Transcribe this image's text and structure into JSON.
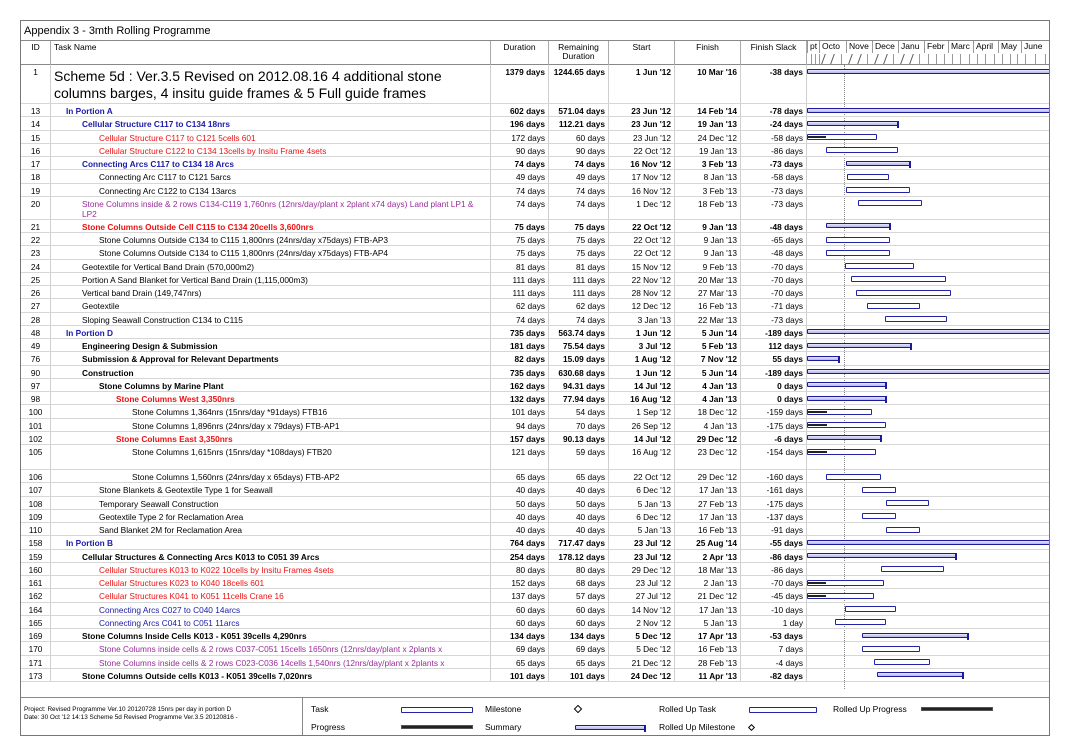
{
  "title": "Appendix 3 - 3mth Rolling Programme",
  "columns": {
    "id": "ID",
    "task_name": "Task Name",
    "duration": "Duration",
    "remaining_duration": "Remaining Duration",
    "start": "Start",
    "finish": "Finish",
    "finish_slack": "Finish Slack"
  },
  "timeline": {
    "months": [
      "pt",
      "Octo",
      "Nove",
      "Dece",
      "Janu",
      "Febr",
      "Marc",
      "April",
      "May",
      "June"
    ]
  },
  "tasks": [
    {
      "id": "1",
      "name": "Scheme 5d : Ver.3.5 Revised on 2012.08.16 4 additional stone columns barges, 4 insitu guide frames & 5 Full guide frames",
      "duration": "1379 days",
      "remaining": "1244.65 days",
      "start": "1 Jun '12",
      "finish": "10 Mar '16",
      "slack": "-38 days",
      "style": "big"
    },
    {
      "id": "13",
      "name": "In Portion A",
      "duration": "602 days",
      "remaining": "571.04 days",
      "start": "23 Jun '12",
      "finish": "14 Feb '14",
      "slack": "-78 days",
      "style": "blue bold",
      "indent": 1
    },
    {
      "id": "14",
      "name": "Cellular Structure C117 to C134 18nrs",
      "duration": "196 days",
      "remaining": "112.21 days",
      "start": "23 Jun '12",
      "finish": "19 Jan '13",
      "slack": "-24 days",
      "style": "blue bold",
      "indent": 2
    },
    {
      "id": "15",
      "name": "Cellular Structure C117 to C121 5cells 601",
      "duration": "172 days",
      "remaining": "60 days",
      "start": "23 Jun '12",
      "finish": "24 Dec '12",
      "slack": "-58 days",
      "style": "red",
      "indent": 3
    },
    {
      "id": "16",
      "name": "Cellular Structure C122 to C134 13cells by Insitu Frame 4sets",
      "duration": "90 days",
      "remaining": "90 days",
      "start": "22 Oct '12",
      "finish": "19 Jan '13",
      "slack": "-86 days",
      "style": "red",
      "indent": 3
    },
    {
      "id": "17",
      "name": "Connecting Arcs C117 to C134 18 Arcs",
      "duration": "74 days",
      "remaining": "74 days",
      "start": "16 Nov '12",
      "finish": "3 Feb '13",
      "slack": "-73 days",
      "style": "blue bold",
      "indent": 2
    },
    {
      "id": "18",
      "name": "Connecting Arc C117 to C121 5arcs",
      "duration": "49 days",
      "remaining": "49 days",
      "start": "17 Nov '12",
      "finish": "8 Jan '13",
      "slack": "-58 days",
      "style": "",
      "indent": 3
    },
    {
      "id": "19",
      "name": "Connecting Arc C122 to C134 13arcs",
      "duration": "74 days",
      "remaining": "74 days",
      "start": "16 Nov '12",
      "finish": "3 Feb '13",
      "slack": "-73 days",
      "style": "",
      "indent": 3
    },
    {
      "id": "20",
      "name": "Stone Columns inside & 2 rows C134-C119 1,760nrs (12nrs/day/plant x 2plant x74 days) Land plant LP1 & LP2",
      "duration": "74 days",
      "remaining": "74 days",
      "start": "1 Dec '12",
      "finish": "18 Feb '13",
      "slack": "-73 days",
      "style": "purple wrap",
      "indent": 2
    },
    {
      "id": "21",
      "name": "Stone Columns Outside Cell C115 to C134 20cells 3,600nrs",
      "duration": "75 days",
      "remaining": "75 days",
      "start": "22 Oct '12",
      "finish": "9 Jan '13",
      "slack": "-48 days",
      "style": "red bold",
      "indent": 2
    },
    {
      "id": "22",
      "name": "Stone Columns Outside C134 to C115 1,800nrs (24nrs/day x75days) FTB-AP3",
      "duration": "75 days",
      "remaining": "75 days",
      "start": "22 Oct '12",
      "finish": "9 Jan '13",
      "slack": "-65 days",
      "style": "",
      "indent": 3
    },
    {
      "id": "23",
      "name": "Stone Columns Outside C134 to C115 1,800nrs (24nrs/day x75days) FTB-AP4",
      "duration": "75 days",
      "remaining": "75 days",
      "start": "22 Oct '12",
      "finish": "9 Jan '13",
      "slack": "-48 days",
      "style": "",
      "indent": 3
    },
    {
      "id": "24",
      "name": "Geotextile for Vertical Band Drain (570,000m2)",
      "duration": "81 days",
      "remaining": "81 days",
      "start": "15 Nov '12",
      "finish": "9 Feb '13",
      "slack": "-70 days",
      "style": "",
      "indent": 2
    },
    {
      "id": "25",
      "name": "Portion A Sand Blanket for Vertical Band Drain (1,115,000m3)",
      "duration": "111 days",
      "remaining": "111 days",
      "start": "22 Nov '12",
      "finish": "20 Mar '13",
      "slack": "-70 days",
      "style": "",
      "indent": 2
    },
    {
      "id": "26",
      "name": "Vertical band Drain (149,747nrs)",
      "duration": "111 days",
      "remaining": "111 days",
      "start": "28 Nov '12",
      "finish": "27 Mar '13",
      "slack": "-70 days",
      "style": "",
      "indent": 2
    },
    {
      "id": "27",
      "name": "Geotextile",
      "duration": "62 days",
      "remaining": "62 days",
      "start": "12 Dec '12",
      "finish": "16 Feb '13",
      "slack": "-71 days",
      "style": "",
      "indent": 2
    },
    {
      "id": "28",
      "name": "Sloping Seawall Construction C134 to C115",
      "duration": "74 days",
      "remaining": "74 days",
      "start": "3 Jan '13",
      "finish": "22 Mar '13",
      "slack": "-73 days",
      "style": "",
      "indent": 2
    },
    {
      "id": "48",
      "name": "In Portion D",
      "duration": "735 days",
      "remaining": "563.74 days",
      "start": "1 Jun '12",
      "finish": "5 Jun '14",
      "slack": "-189 days",
      "style": "blue bold",
      "indent": 1
    },
    {
      "id": "49",
      "name": "Engineering Design & Submission",
      "duration": "181 days",
      "remaining": "75.54 days",
      "start": "3 Jul '12",
      "finish": "5 Feb '13",
      "slack": "112 days",
      "style": "bold",
      "indent": 2
    },
    {
      "id": "76",
      "name": "Submission & Approval for Relevant Departments",
      "duration": "82 days",
      "remaining": "15.09 days",
      "start": "1 Aug '12",
      "finish": "7 Nov '12",
      "slack": "55 days",
      "style": "bold",
      "indent": 2
    },
    {
      "id": "90",
      "name": "Construction",
      "duration": "735 days",
      "remaining": "630.68 days",
      "start": "1 Jun '12",
      "finish": "5 Jun '14",
      "slack": "-189 days",
      "style": "bold",
      "indent": 2
    },
    {
      "id": "97",
      "name": "Stone Columns by Marine Plant",
      "duration": "162 days",
      "remaining": "94.31 days",
      "start": "14 Jul '12",
      "finish": "4 Jan '13",
      "slack": "0 days",
      "style": "bold",
      "indent": 3
    },
    {
      "id": "98",
      "name": "Stone Columns West 3,350nrs",
      "duration": "132 days",
      "remaining": "77.94 days",
      "start": "16 Aug '12",
      "finish": "4 Jan '13",
      "slack": "0 days",
      "style": "red bold",
      "indent": 4
    },
    {
      "id": "100",
      "name": "Stone Columns 1,364nrs (15nrs/day *91days) FTB16",
      "duration": "101 days",
      "remaining": "54 days",
      "start": "1 Sep '12",
      "finish": "18 Dec '12",
      "slack": "-159 days",
      "style": "",
      "indent": 5
    },
    {
      "id": "101",
      "name": "Stone Columns 1,896nrs (24nrs/day x 79days) FTB-AP1",
      "duration": "94 days",
      "remaining": "70 days",
      "start": "26 Sep '12",
      "finish": "4 Jan '13",
      "slack": "-175 days",
      "style": "",
      "indent": 5
    },
    {
      "id": "102",
      "name": "Stone Columns East 3,350nrs",
      "duration": "157 days",
      "remaining": "90.13 days",
      "start": "14 Jul '12",
      "finish": "29 Dec '12",
      "slack": "-6 days",
      "style": "red bold",
      "indent": 4
    },
    {
      "id": "105",
      "name": "Stone Columns 1,615nrs (15nrs/day *108days) FTB20",
      "duration": "121 days",
      "remaining": "59 days",
      "start": "16 Aug '12",
      "finish": "23 Dec '12",
      "slack": "-154 days",
      "style": "",
      "indent": 5
    },
    {
      "id": "106",
      "name": "Stone Columns 1,560nrs (24nrs/day x 65days) FTB-AP2",
      "duration": "65 days",
      "remaining": "65 days",
      "start": "22 Oct '12",
      "finish": "29 Dec '12",
      "slack": "-160 days",
      "style": "",
      "indent": 5
    },
    {
      "id": "107",
      "name": "Stone Blankets & Geotextile Type 1 for Seawall",
      "duration": "40 days",
      "remaining": "40 days",
      "start": "6 Dec '12",
      "finish": "17 Jan '13",
      "slack": "-161 days",
      "style": "",
      "indent": 3
    },
    {
      "id": "108",
      "name": "Temporary Seawall Construction",
      "duration": "50 days",
      "remaining": "50 days",
      "start": "5 Jan '13",
      "finish": "27 Feb '13",
      "slack": "-175 days",
      "style": "",
      "indent": 3
    },
    {
      "id": "109",
      "name": "Geotextile Type 2 for Reclamation Area",
      "duration": "40 days",
      "remaining": "40 days",
      "start": "6 Dec '12",
      "finish": "17 Jan '13",
      "slack": "-137 days",
      "style": "",
      "indent": 3
    },
    {
      "id": "110",
      "name": "Sand Blanket 2M for Reclamation Area",
      "duration": "40 days",
      "remaining": "40 days",
      "start": "5 Jan '13",
      "finish": "16 Feb '13",
      "slack": "-91 days",
      "style": "",
      "indent": 3
    },
    {
      "id": "158",
      "name": "In Portion B",
      "duration": "764 days",
      "remaining": "717.47 days",
      "start": "23 Jul '12",
      "finish": "25 Aug '14",
      "slack": "-55 days",
      "style": "blue bold",
      "indent": 1
    },
    {
      "id": "159",
      "name": "Cellular Structures & Connecting Arcs K013 to C051 39 Arcs",
      "duration": "254 days",
      "remaining": "178.12 days",
      "start": "23 Jul '12",
      "finish": "2 Apr '13",
      "slack": "-86 days",
      "style": "bold",
      "indent": 2
    },
    {
      "id": "160",
      "name": "Cellular Structures K013 to K022 10cells by Insitu Frames 4sets",
      "duration": "80 days",
      "remaining": "80 days",
      "start": "29 Dec '12",
      "finish": "18 Mar '13",
      "slack": "-86 days",
      "style": "red",
      "indent": 3
    },
    {
      "id": "161",
      "name": "Cellular Structures K023 to K040 18cells 601",
      "duration": "152 days",
      "remaining": "68 days",
      "start": "23 Jul '12",
      "finish": "2 Jan '13",
      "slack": "-70 days",
      "style": "red",
      "indent": 3
    },
    {
      "id": "162",
      "name": "Cellular Structures K041 to K051 11cells Crane 16",
      "duration": "137 days",
      "remaining": "57 days",
      "start": "27 Jul '12",
      "finish": "21 Dec '12",
      "slack": "-45 days",
      "style": "red",
      "indent": 3
    },
    {
      "id": "164",
      "name": "Connecting Arcs C027 to C040 14arcs",
      "duration": "60 days",
      "remaining": "60 days",
      "start": "14 Nov '12",
      "finish": "17 Jan '13",
      "slack": "-10 days",
      "style": "blue",
      "indent": 3
    },
    {
      "id": "165",
      "name": "Connecting Arcs C041 to C051 11arcs",
      "duration": "60 days",
      "remaining": "60 days",
      "start": "2 Nov '12",
      "finish": "5 Jan '13",
      "slack": "1 day",
      "style": "blue",
      "indent": 3
    },
    {
      "id": "169",
      "name": "Stone Columns Inside Cells K013 - K051 39cells 4,290nrs",
      "duration": "134 days",
      "remaining": "134 days",
      "start": "5 Dec '12",
      "finish": "17 Apr '13",
      "slack": "-53 days",
      "style": "bold",
      "indent": 2
    },
    {
      "id": "170",
      "name": "Stone Columns inside cells & 2 rows C037-C051 15cells 1650nrs (12nrs/day/plant x 2plants x",
      "duration": "69 days",
      "remaining": "69 days",
      "start": "5 Dec '12",
      "finish": "16 Feb '13",
      "slack": "7 days",
      "style": "purple",
      "indent": 3
    },
    {
      "id": "171",
      "name": "Stone Columns inside cells & 2 rows C023-C036 14cells 1,540nrs (12nrs/day/plant x 2plants x",
      "duration": "65 days",
      "remaining": "65 days",
      "start": "21 Dec '12",
      "finish": "28 Feb '13",
      "slack": "-4 days",
      "style": "purple",
      "indent": 3
    },
    {
      "id": "173",
      "name": "Stone Columns Outside cells K013 - K051 39cells 7,020nrs",
      "duration": "101 days",
      "remaining": "101 days",
      "start": "24 Dec '12",
      "finish": "11 Apr '13",
      "slack": "-82 days",
      "style": "bold",
      "indent": 2
    }
  ],
  "legend": {
    "project": "Project: Revised Programme Ver.10 20120728 15nrs per day in portion D",
    "date": "Date: 30 Oct '12 14:13    Scheme 5d Revised Programme Ver.3.5 20120816 -",
    "task": "Task",
    "progress": "Progress",
    "milestone": "Milestone",
    "summary": "Summary",
    "rolled_up_task": "Rolled Up Task",
    "rolled_up_milestone": "Rolled Up Milestone",
    "rolled_up_progress": "Rolled Up Progress"
  }
}
